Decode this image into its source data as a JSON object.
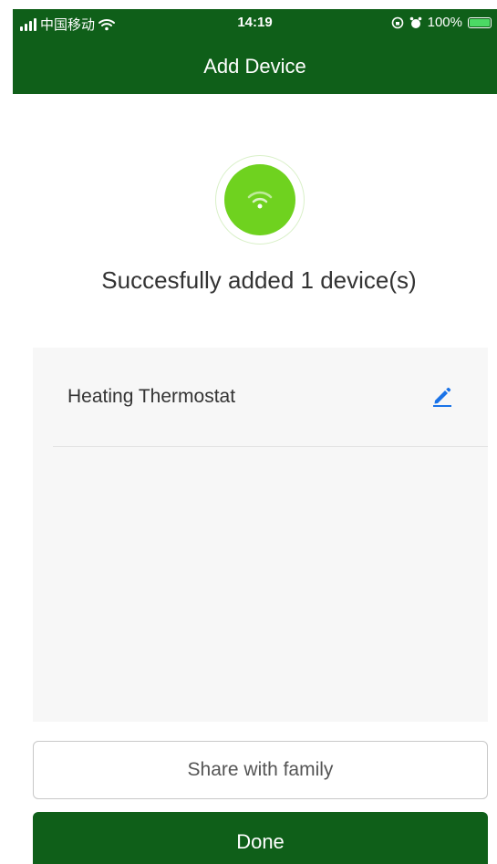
{
  "status_bar": {
    "carrier": "中国移动",
    "time": "14:19",
    "battery_percent": "100%",
    "icons": [
      "signal-icon",
      "wifi-icon",
      "orientation-lock-icon",
      "alarm-icon",
      "battery-icon"
    ],
    "battery_level": 1.0
  },
  "header": {
    "title": "Add Device",
    "background_color": "#0f5f19"
  },
  "success": {
    "icon": "wifi-icon",
    "icon_color": "#6fd21f",
    "message": "Succesfully added 1 device(s)"
  },
  "devices": [
    {
      "name": "Heating Thermostat",
      "action_icon": "edit-pencil-icon",
      "action_color": "#1a73e8"
    }
  ],
  "buttons": {
    "share_label": "Share with family",
    "done_label": "Done",
    "done_color": "#0f5f19"
  }
}
